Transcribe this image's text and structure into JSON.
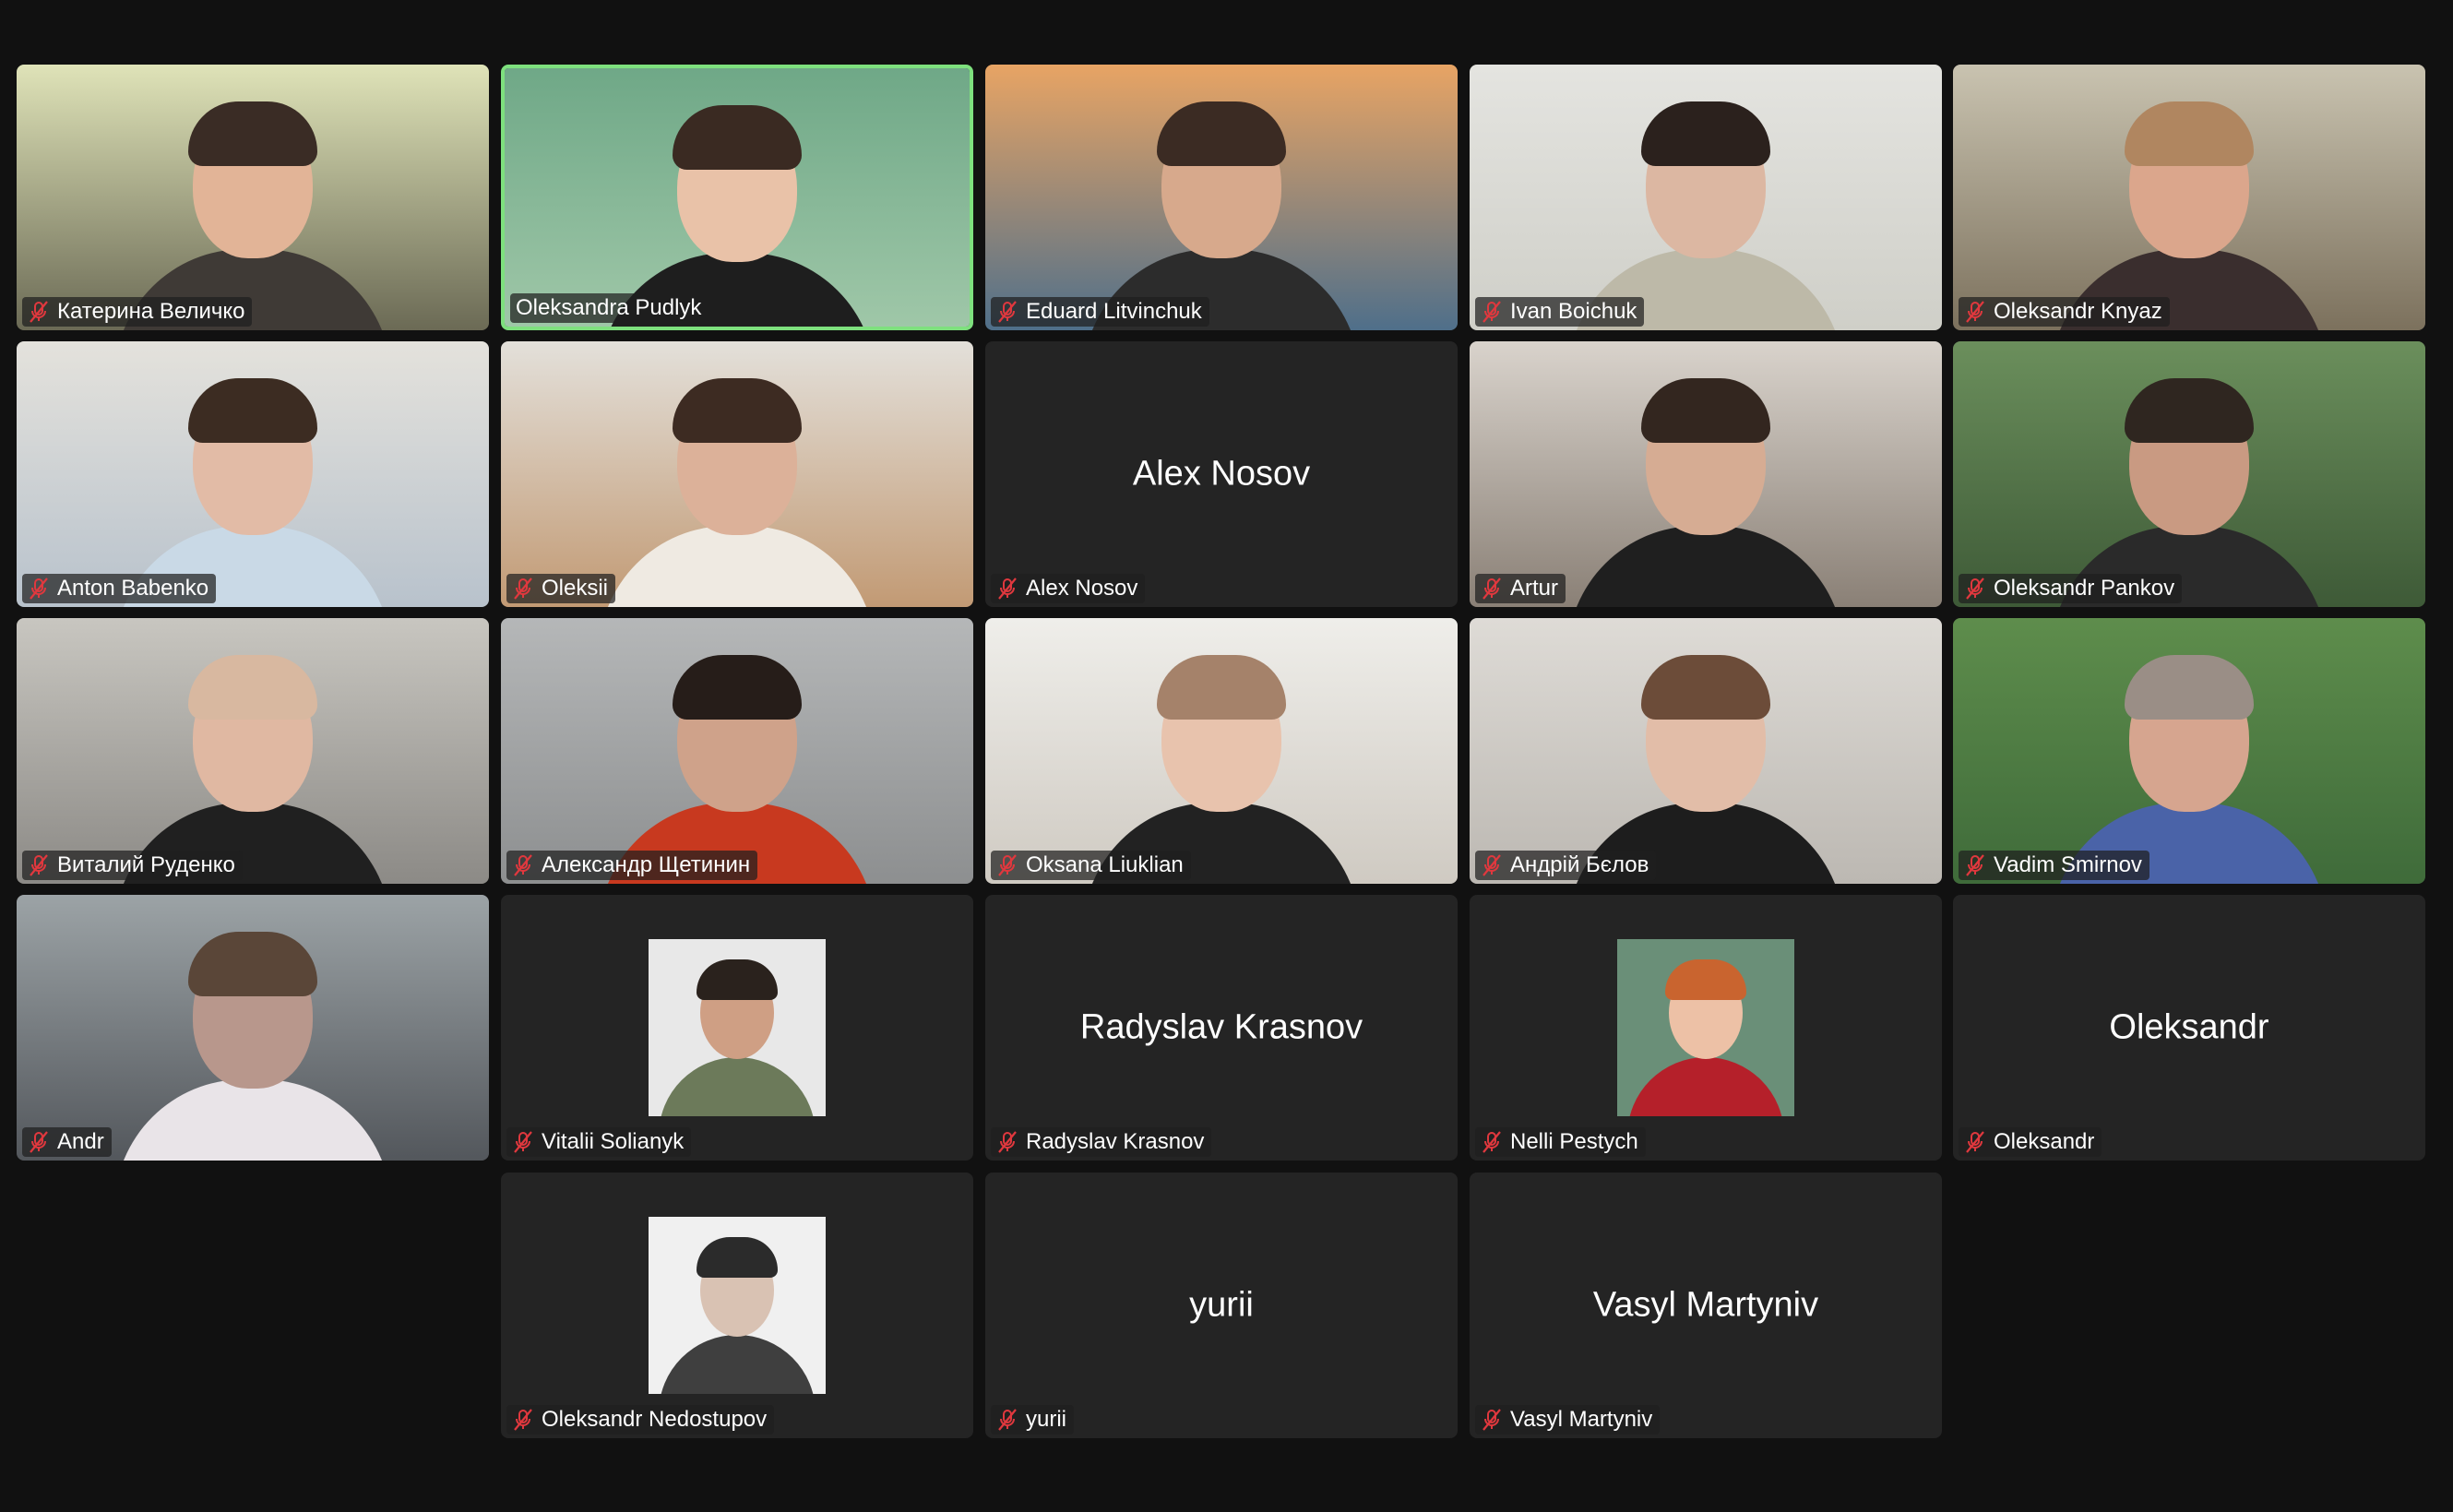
{
  "app": {
    "view": "gallery",
    "background_color": "#111111",
    "tile_color": "#242424",
    "active_speaker_border": "#7ee07e",
    "muted_icon_color": "#e0383e"
  },
  "participants": [
    {
      "name": "Катерина Величко",
      "muted": true,
      "display": "video"
    },
    {
      "name": "Oleksandra Pudlyk",
      "muted": false,
      "display": "video",
      "active_speaker": true
    },
    {
      "name": "Eduard Litvinchuk",
      "muted": true,
      "display": "video"
    },
    {
      "name": "Ivan Boichuk",
      "muted": true,
      "display": "video"
    },
    {
      "name": "Oleksandr Knyaz",
      "muted": true,
      "display": "video"
    },
    {
      "name": "Anton Babenko",
      "muted": true,
      "display": "video"
    },
    {
      "name": "Oleksii",
      "muted": true,
      "display": "video"
    },
    {
      "name": "Alex Nosov",
      "muted": true,
      "display": "name",
      "center_label": "Alex Nosov"
    },
    {
      "name": "Artur",
      "muted": true,
      "display": "video"
    },
    {
      "name": "Oleksandr Pankov",
      "muted": true,
      "display": "video"
    },
    {
      "name": "Виталий Руденко",
      "muted": true,
      "display": "video"
    },
    {
      "name": "Александр Щетинин",
      "muted": true,
      "display": "video"
    },
    {
      "name": "Oksana Liuklian",
      "muted": true,
      "display": "video"
    },
    {
      "name": "Андрій Бєлов",
      "muted": true,
      "display": "video"
    },
    {
      "name": "Vadim Smirnov",
      "muted": true,
      "display": "video"
    },
    {
      "name": "Andr",
      "muted": true,
      "display": "video"
    },
    {
      "name": "Vitalii Solianyk",
      "muted": true,
      "display": "photo"
    },
    {
      "name": "Radyslav Krasnov",
      "muted": true,
      "display": "name",
      "center_label": "Radyslav Krasnov"
    },
    {
      "name": "Nelli Pestych",
      "muted": true,
      "display": "photo"
    },
    {
      "name": "Oleksandr",
      "muted": true,
      "display": "name",
      "center_label": "Oleksandr"
    },
    {
      "name": "Oleksandr Nedostupov",
      "muted": true,
      "display": "photo"
    },
    {
      "name": "yurii",
      "muted": true,
      "display": "name",
      "center_label": "yurii"
    },
    {
      "name": "Vasyl Martyniv",
      "muted": true,
      "display": "name",
      "center_label": "Vasyl Martyniv"
    }
  ]
}
